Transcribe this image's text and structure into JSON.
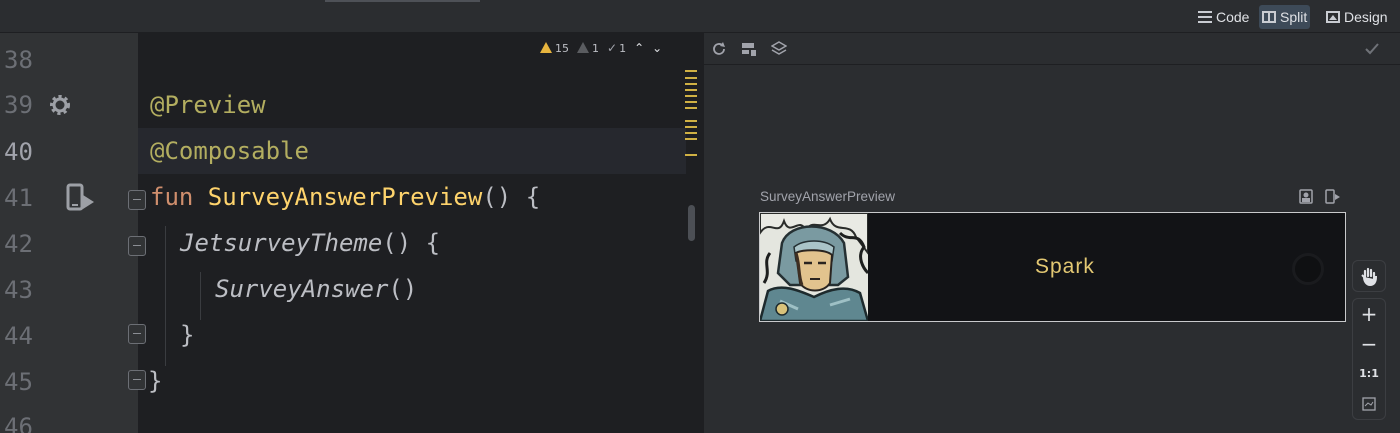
{
  "view_modes": [
    {
      "label": "Code",
      "icon": "code-view-icon",
      "active": false
    },
    {
      "label": "Split",
      "icon": "split-view-icon",
      "active": true
    },
    {
      "label": "Design",
      "icon": "design-view-icon",
      "active": false
    }
  ],
  "editor": {
    "line_numbers": [
      "38",
      "39",
      "40",
      "41",
      "42",
      "43",
      "44",
      "45",
      "46"
    ],
    "current_line": "40",
    "lines": {
      "l39": "@Preview",
      "l40": "@Composable",
      "l41_kw": "fun ",
      "l41_name": "SurveyAnswerPreview",
      "l41_rest": "() {",
      "l42_name": "JetsurveyTheme",
      "l42_rest": "() {",
      "l43_name": "SurveyAnswer",
      "l43_rest": "()",
      "l44": "}",
      "l45": "}"
    },
    "inspections": {
      "warnings": "15",
      "weak_warnings": "1",
      "typos": "1"
    },
    "gutter_icons": [
      "gear-icon",
      "run-preview-icon"
    ]
  },
  "preview": {
    "toolbar_icons": [
      "refresh-icon",
      "layout-icon",
      "layers-icon",
      "check-icon"
    ],
    "composable_name": "SurveyAnswerPreview",
    "answer_text": "Spark",
    "colors": {
      "answer_text": "#e3c873",
      "card_background": "#121316",
      "card_border": "#c9cacc"
    },
    "zoom_controls": [
      "pan-icon",
      "+",
      "−",
      "1:1",
      "fit-screen-icon"
    ]
  }
}
